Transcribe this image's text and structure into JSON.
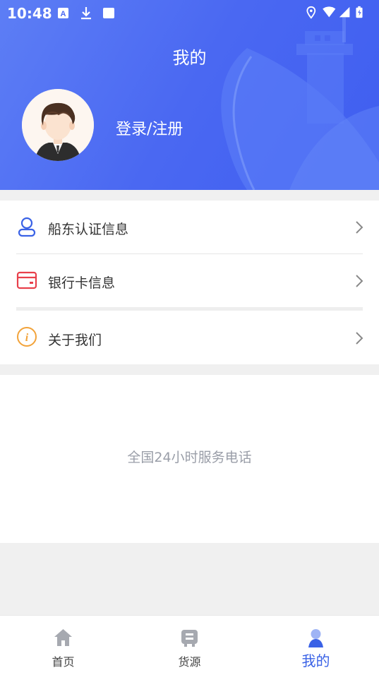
{
  "status_bar": {
    "time": "10:48",
    "left_icons": [
      "a-notification-icon",
      "download-icon",
      "square-notification-icon"
    ],
    "right_icons": [
      "location-icon",
      "wifi-icon",
      "cell-signal-icon",
      "battery-icon"
    ]
  },
  "header": {
    "title": "我的",
    "login_label": "登录/注册",
    "gradient_start": "#5d7ef5",
    "gradient_end": "#3f5ef0"
  },
  "menu": {
    "items": [
      {
        "label": "船东认证信息",
        "icon": "person-icon",
        "icon_color": "#3a62e6"
      },
      {
        "label": "银行卡信息",
        "icon": "card-icon",
        "icon_color": "#e8404b"
      },
      {
        "label": "关于我们",
        "icon": "info-icon",
        "icon_color": "#f2a33a"
      }
    ]
  },
  "service": {
    "text": "全国24小时服务电话"
  },
  "bottom_nav": {
    "items": [
      {
        "label": "首页",
        "icon": "home-icon"
      },
      {
        "label": "货源",
        "icon": "cargo-icon"
      },
      {
        "label": "我的",
        "icon": "profile-icon",
        "active": true
      }
    ],
    "active_color": "#3a62e6"
  }
}
